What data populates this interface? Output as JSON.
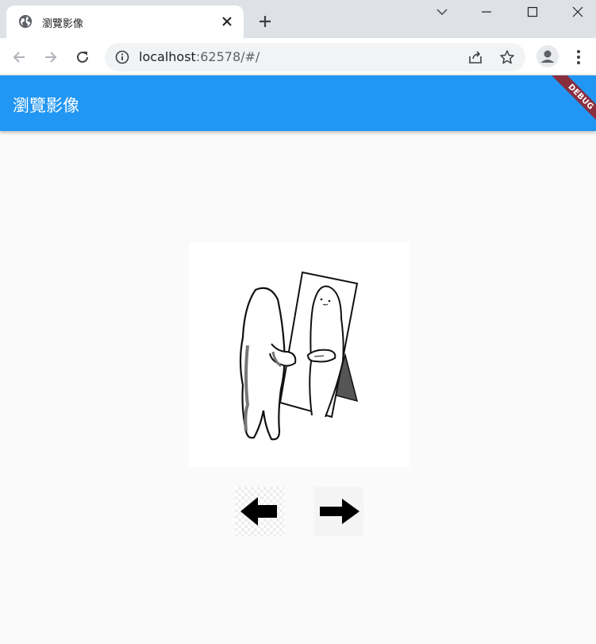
{
  "browser": {
    "tab_title": "瀏覽影像",
    "url_host": "localhost",
    "url_rest": ":62578/#/"
  },
  "app": {
    "title": "瀏覽影像",
    "debug_label": "DEBUG",
    "primary_color": "#2196f3"
  },
  "viewer": {
    "image_icon": "ghost-mirror-illustration",
    "prev_icon": "arrow-left-icon",
    "next_icon": "arrow-right-icon"
  }
}
